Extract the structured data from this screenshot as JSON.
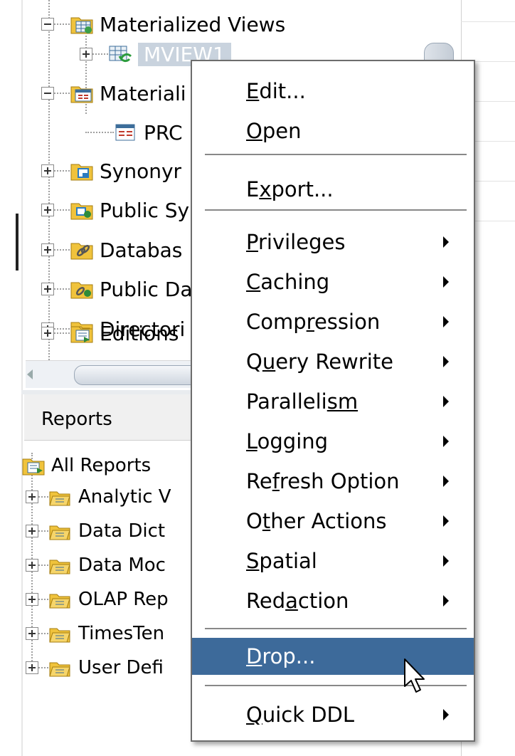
{
  "tree": {
    "materialized_views": "Materialized Views",
    "mview1": "MVIEW1",
    "materialized_view_logs": "Materiali",
    "pro": "PRC",
    "synonyms": "Synonyr",
    "public_synonyms": "Public Sy",
    "database_links": "Databas",
    "public_database_links": "Public Da",
    "directories": "Directori",
    "editions": "Editions"
  },
  "reports": {
    "title": "Reports",
    "all_reports": "All Reports",
    "items": [
      "Analytic V",
      "Data Dict",
      "Data Moc",
      "OLAP Rep",
      "TimesTen",
      "User Defi"
    ]
  },
  "menu": {
    "items": [
      {
        "label": "Edit...",
        "mn": "E",
        "rest": "dit..."
      },
      {
        "label": "Open",
        "mn": "O",
        "rest": "pen"
      },
      {
        "label": "Export...",
        "pre": "E",
        "mn": "x",
        "rest": "port..."
      },
      {
        "label": "Privileges",
        "mn": "P",
        "rest": "rivileges"
      },
      {
        "label": "Caching",
        "mn": "C",
        "rest": "aching"
      },
      {
        "label": "Compression",
        "pre": "Comp",
        "mn": "r",
        "rest": "ession"
      },
      {
        "label": "Query Rewrite",
        "pre": "Q",
        "mn": "u",
        "rest": "ery Rewrite"
      },
      {
        "label": "Parallelism",
        "pre": "Paralleli",
        "mn": "sm",
        "rest": ""
      },
      {
        "label": "Logging",
        "mn": "L",
        "rest": "ogging"
      },
      {
        "label": "Refresh Option",
        "pre": "Re",
        "mn": "f",
        "rest": "resh Option"
      },
      {
        "label": "Other Actions",
        "pre": "O",
        "mn": "t",
        "rest": "her Actions"
      },
      {
        "label": "Spatial",
        "mn": "S",
        "rest": "patial"
      },
      {
        "label": "Redaction",
        "pre": "Red",
        "mn": "a",
        "rest": "ction"
      },
      {
        "label": "Drop...",
        "mn": "D",
        "rest": "rop..."
      },
      {
        "label": "Quick DDL",
        "mn": "Q",
        "rest": "uick DDL"
      }
    ]
  },
  "colors": {
    "highlight": "#3d6a9a",
    "selection": "#c9d3de",
    "folder": "#f0c33c"
  }
}
